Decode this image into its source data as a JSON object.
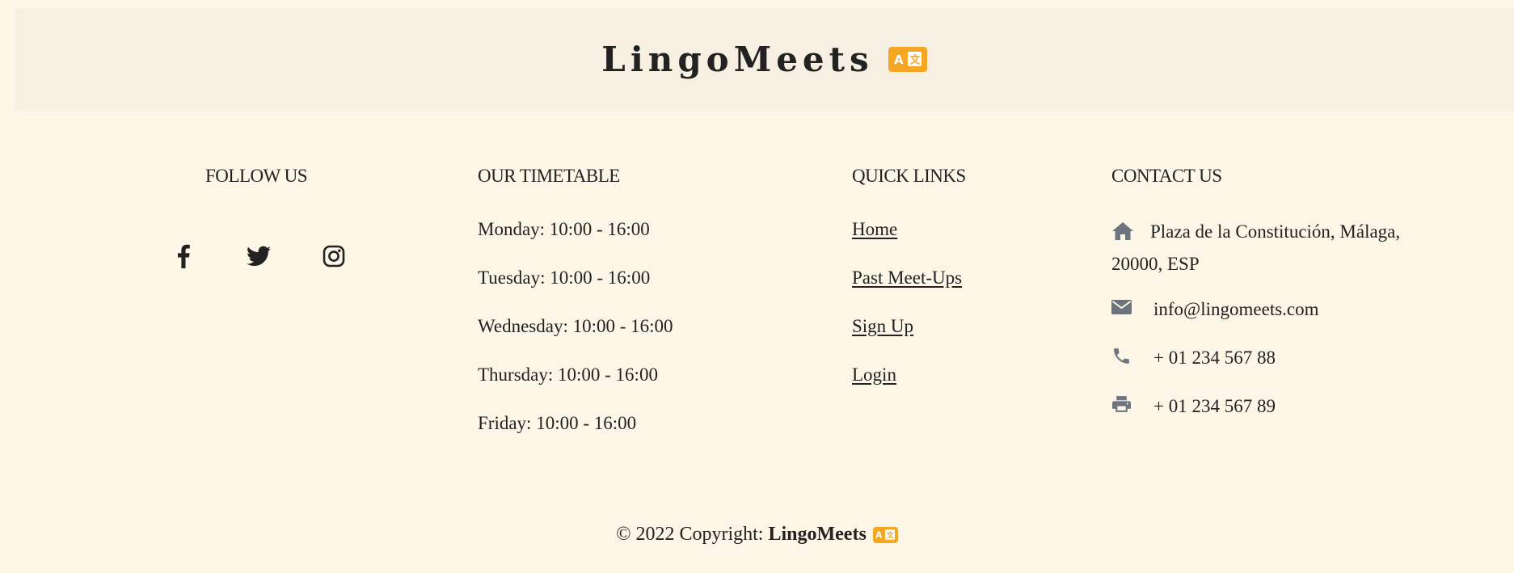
{
  "brand": {
    "name": "LingoMeets",
    "badge_color": "#f5a623",
    "badge_icon": "translate-icon"
  },
  "follow": {
    "heading": "FOLLOW US",
    "icons": [
      "facebook-icon",
      "twitter-icon",
      "instagram-icon"
    ]
  },
  "timetable": {
    "heading": "OUR TIMETABLE",
    "rows": [
      "Monday: 10:00 - 16:00",
      "Tuesday: 10:00 - 16:00",
      "Wednesday: 10:00 - 16:00",
      "Thursday: 10:00 - 16:00",
      "Friday: 10:00 - 16:00"
    ]
  },
  "quick_links": {
    "heading": "QUICK LINKS",
    "items": [
      "Home",
      "Past Meet-Ups",
      "Sign Up",
      "Login"
    ]
  },
  "contact": {
    "heading": "CONTACT US",
    "address": "Plaza de la Constitución, Málaga, 20000, ESP",
    "email": "info@lingomeets.com",
    "phone": "+ 01 234 567 88",
    "fax": "+ 01 234 567 89",
    "icon_color": "#6c757d"
  },
  "footer": {
    "copyright_prefix": "© 2022 Copyright:",
    "brand": "LingoMeets"
  },
  "colors": {
    "page_bg": "#fdf6e7",
    "banner_bg": "#f7efe1",
    "text": "#222222"
  }
}
